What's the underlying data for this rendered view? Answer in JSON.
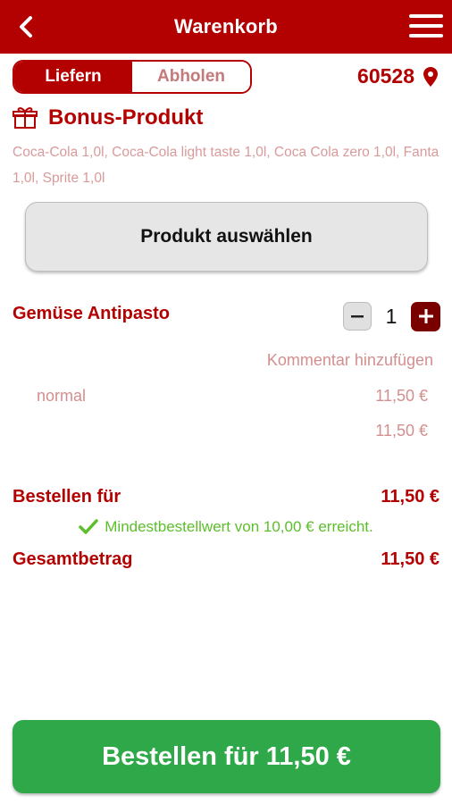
{
  "header": {
    "title": "Warenkorb",
    "back_icon": "chevron-left-icon",
    "menu_icon": "hamburger-menu-icon"
  },
  "delivery_toggle": {
    "options": [
      "Liefern",
      "Abholen"
    ],
    "selected": "Liefern"
  },
  "location": {
    "zip": "60528",
    "icon": "map-pin-icon"
  },
  "bonus": {
    "title": "Bonus-Produkt",
    "icon": "gift-icon",
    "description": "Coca-Cola 1,0l, Coca-Cola light taste 1,0l, Coca Cola zero 1,0l, Fanta 1,0l, Sprite 1,0l",
    "select_label": "Produkt auswählen"
  },
  "cart": {
    "items": [
      {
        "name": "Gemüse Antipasto",
        "quantity": "1",
        "comment_label": "Kommentar hinzufügen",
        "variant": "normal",
        "variant_price": "11,50 €",
        "total": "11,50 €"
      }
    ]
  },
  "summary": {
    "order_for_label": "Bestellen für",
    "order_for_value": "11,50 €",
    "min_order_note": "Mindestbestellwert von 10,00 € erreicht.",
    "total_label": "Gesamtbetrag",
    "total_value": "11,50 €"
  },
  "checkout": {
    "button_label": "Bestellen für 11,50 €"
  },
  "colors": {
    "brand_red": "#b30000",
    "dark_red": "#7a0000",
    "success_green": "#2fa84a",
    "check_green": "#5bbf2a"
  }
}
